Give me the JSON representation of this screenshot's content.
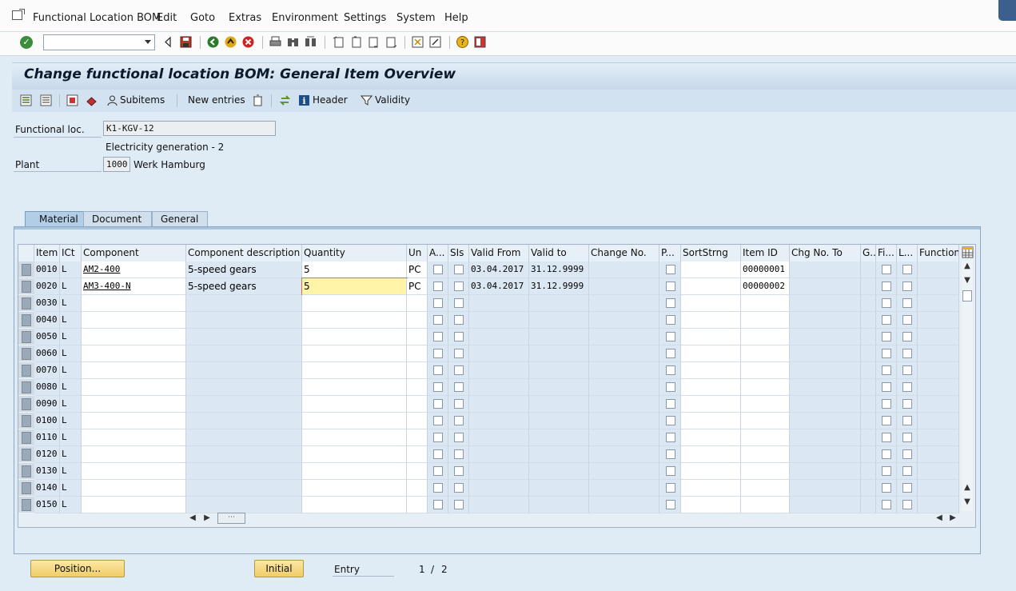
{
  "menubar": {
    "items": [
      "Functional Location BOM",
      "Edit",
      "Goto",
      "Extras",
      "Environment",
      "Settings",
      "System",
      "Help"
    ]
  },
  "toolbar": {
    "command_field": ""
  },
  "title": "Change functional location BOM: General Item Overview",
  "app_toolbar": {
    "subitems": "Subitems",
    "new_entries": "New entries",
    "header": "Header",
    "validity": "Validity"
  },
  "header_fields": {
    "functional_loc_label": "Functional loc.",
    "functional_loc_value": "K1-KGV-12",
    "functional_loc_desc": "Electricity generation - 2",
    "plant_label": "Plant",
    "plant_value": "1000",
    "plant_name": "Werk Hamburg"
  },
  "tabs": [
    "Material",
    "Document",
    "General"
  ],
  "table": {
    "columns": [
      "Item",
      "ICt",
      "Component",
      "Component description",
      "Quantity",
      "Un",
      "A...",
      "SIs",
      "Valid From",
      "Valid to",
      "Change No.",
      "P...",
      "SortStrng",
      "Item ID",
      "Chg No. To",
      "G...",
      "Fi...",
      "L...",
      "Function"
    ],
    "rows": [
      {
        "item": "0010",
        "ict": "L",
        "component": "AM2-400",
        "desc": "5-speed gears",
        "qty": "5",
        "un": "PC",
        "from": "03.04.2017",
        "to": "31.12.9999",
        "id": "00000001"
      },
      {
        "item": "0020",
        "ict": "L",
        "component": "AM3-400-N",
        "desc": "5-speed gears",
        "qty": "5",
        "un": "PC",
        "from": "03.04.2017",
        "to": "31.12.9999",
        "id": "00000002"
      },
      {
        "item": "0030",
        "ict": "L"
      },
      {
        "item": "0040",
        "ict": "L"
      },
      {
        "item": "0050",
        "ict": "L"
      },
      {
        "item": "0060",
        "ict": "L"
      },
      {
        "item": "0070",
        "ict": "L"
      },
      {
        "item": "0080",
        "ict": "L"
      },
      {
        "item": "0090",
        "ict": "L"
      },
      {
        "item": "0100",
        "ict": "L"
      },
      {
        "item": "0110",
        "ict": "L"
      },
      {
        "item": "0120",
        "ict": "L"
      },
      {
        "item": "0130",
        "ict": "L"
      },
      {
        "item": "0140",
        "ict": "L"
      },
      {
        "item": "0150",
        "ict": "L"
      }
    ]
  },
  "footer": {
    "position_btn": "Position...",
    "initial_btn": "Initial",
    "entry_label": "Entry",
    "entry_current": "1",
    "entry_sep": "/",
    "entry_total": "2"
  }
}
